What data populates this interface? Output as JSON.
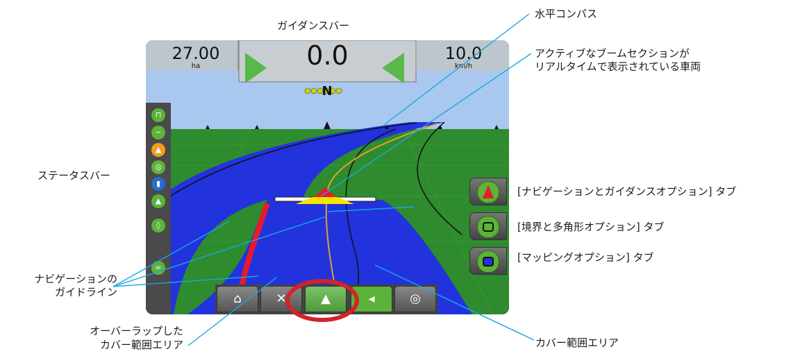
{
  "display": {
    "area_value": "27.00",
    "area_unit": "ha",
    "guidance_value": "0.0",
    "speed_value": "10.0",
    "speed_unit": "km/h",
    "compass_heading": "N"
  },
  "labels": {
    "guidance_bar": "ガイダンスバー",
    "horizontal_compass": "水平コンパス",
    "vehicle_line1": "アクティブなブームセクションが",
    "vehicle_line2": "リアルタイムで表示されている車両",
    "status_bar": "ステータスバー",
    "nav_guidance_tab": "[ナビゲーションとガイダンスオプション] タブ",
    "boundary_tab": "[境界と多角形オプション] タブ",
    "mapping_tab": "[マッピングオプション] タブ",
    "nav_guideline_line1": "ナビゲーションの",
    "nav_guideline_line2": "ガイドライン",
    "overlap_line1": "オーバーラップした",
    "overlap_line2": "カバー範囲エリア",
    "coverage_area": "カバー範囲エリア"
  },
  "colors": {
    "sky": "#a8c8f0",
    "field": "#2e8b2e",
    "coverage": "#2233dd",
    "overlap": "#e8192c",
    "guideline": "#e0a030",
    "annotation_line": "#1aa7e0",
    "highlight_circle": "#d3232a"
  },
  "icons": {
    "status": [
      "steering-icon",
      "guidance-mode-icon",
      "vehicle-icon",
      "gnss-icon",
      "boom-icon",
      "field-icon",
      "flow-icon",
      "section-icon"
    ],
    "bottom_tabs": [
      "home-icon",
      "tools-icon",
      "guidance-icon",
      "field-view-icon",
      "rtk-icon"
    ]
  }
}
